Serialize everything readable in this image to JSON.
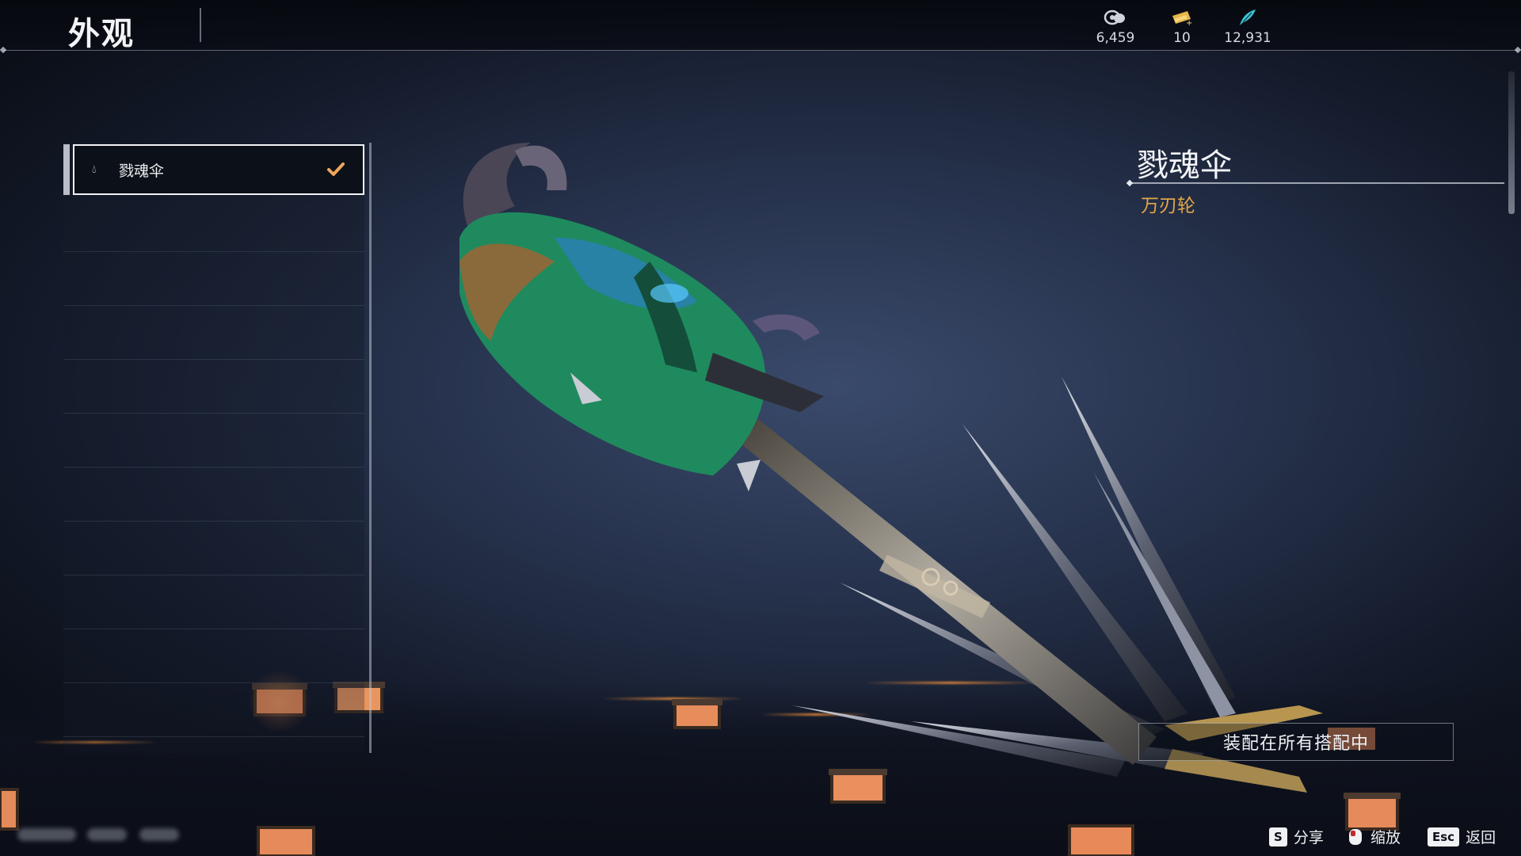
{
  "header": {
    "title": "外观",
    "currencies": [
      {
        "icon": "coin-stack-icon",
        "value": "6,459"
      },
      {
        "icon": "gold-ticket-icon",
        "value": "10"
      },
      {
        "icon": "jade-feather-icon",
        "value": "12,931"
      }
    ]
  },
  "skin_list": {
    "selected": {
      "icon": "drop-icon",
      "label": "戮魂伞",
      "status_icon": "check-icon"
    }
  },
  "detail": {
    "name": "戮魂伞",
    "weapon_type": "万刃轮",
    "equip_button": "装配在所有搭配中"
  },
  "footer": {
    "hints": [
      {
        "key": "S",
        "label": "分享"
      },
      {
        "key": "mouse-right-icon",
        "label": "缩放"
      },
      {
        "key": "Esc",
        "label": "返回"
      }
    ]
  },
  "colors": {
    "accent_gold": "#e2a64a",
    "check_orange": "#f0a65a",
    "background_deep": "#141a2a"
  }
}
